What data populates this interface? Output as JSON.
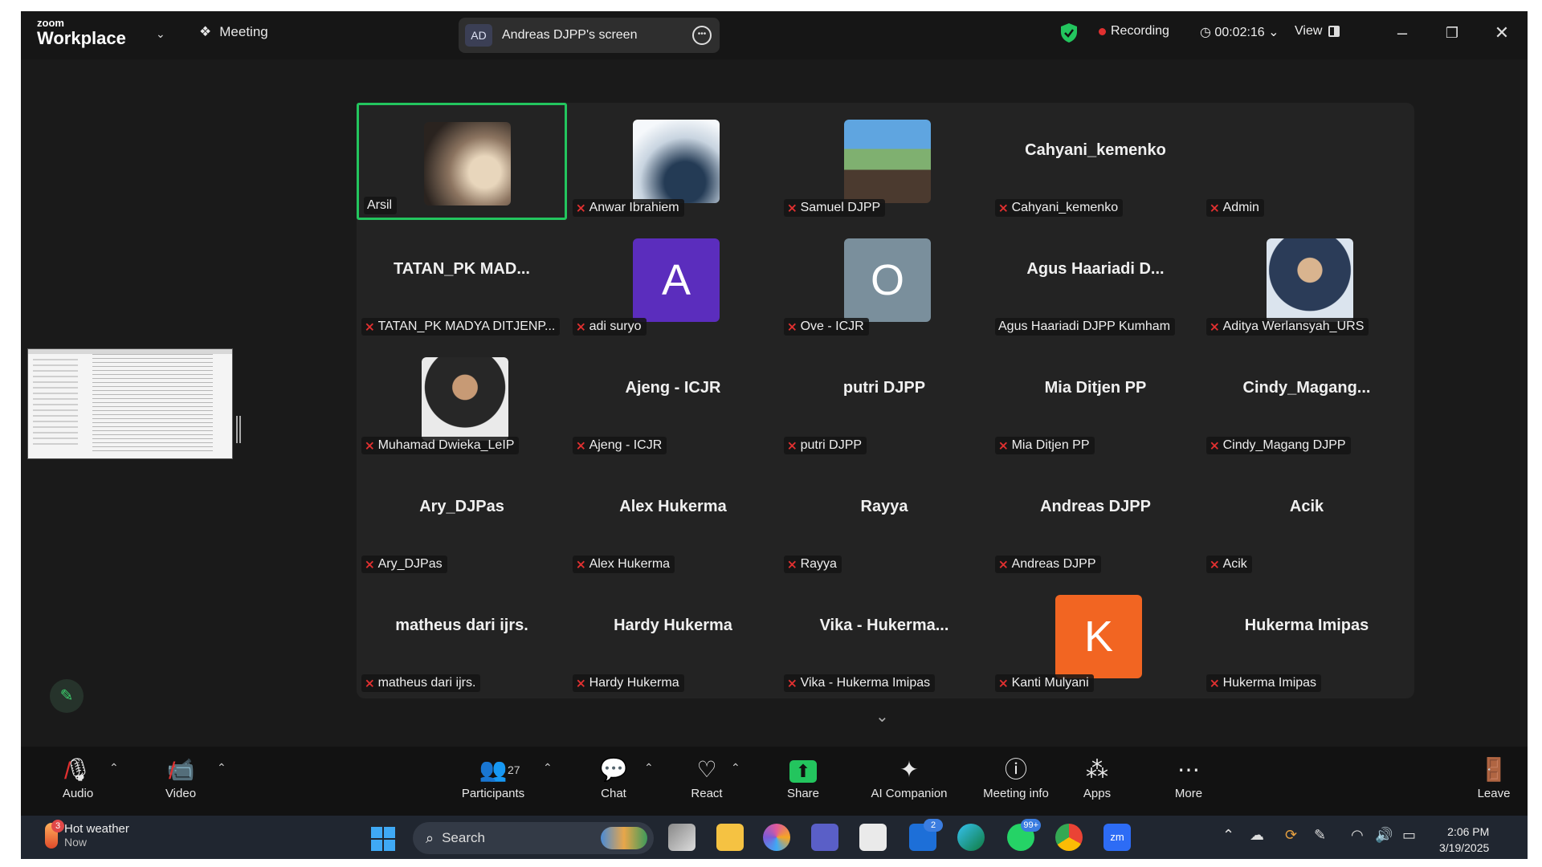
{
  "topbar": {
    "brand_small": "zoom",
    "brand_big": "Workplace",
    "meeting_label": "Meeting",
    "share_initials": "AD",
    "share_text": "Andreas DJPP's screen",
    "recording_label": "Recording",
    "timer": "00:02:16",
    "view_label": "View"
  },
  "participants": [
    {
      "name": "Arsil",
      "display": "",
      "avatar": "photo-arsil",
      "muted": false,
      "active": true
    },
    {
      "name": "Anwar Ibrahiem",
      "display": "",
      "avatar": "photo-anwar",
      "muted": true
    },
    {
      "name": "Samuel DJPP",
      "display": "",
      "avatar": "photo-samuel",
      "muted": true
    },
    {
      "name": "Cahyani_kemenko",
      "display": "Cahyani_kemenko",
      "muted": true
    },
    {
      "name": "Admin",
      "display": "",
      "muted": true
    },
    {
      "name": "TATAN_PK MADYA DITJENP...",
      "display": "TATAN_PK MAD...",
      "muted": true
    },
    {
      "name": "adi suryo",
      "display": "",
      "letter": "A",
      "color": "#5b2dbd",
      "muted": true
    },
    {
      "name": "Ove - ICJR",
      "display": "",
      "letter": "O",
      "color": "#7a8f9c",
      "muted": true
    },
    {
      "name": "Agus Haariadi DJPP Kumham",
      "display": "Agus Haariadi D...",
      "muted": false
    },
    {
      "name": "Aditya Werlansyah_URS",
      "display": "",
      "avatar": "photo-aditya",
      "muted": true
    },
    {
      "name": "Muhamad Dwieka_LeIP",
      "display": "",
      "avatar": "photo-dwieka",
      "muted": true
    },
    {
      "name": "Ajeng - ICJR",
      "display": "Ajeng - ICJR",
      "muted": true
    },
    {
      "name": "putri DJPP",
      "display": "putri DJPP",
      "muted": true
    },
    {
      "name": "Mia Ditjen PP",
      "display": "Mia Ditjen PP",
      "muted": true
    },
    {
      "name": "Cindy_Magang DJPP",
      "display": "Cindy_Magang...",
      "muted": true
    },
    {
      "name": "Ary_DJPas",
      "display": "Ary_DJPas",
      "muted": true
    },
    {
      "name": "Alex Hukerma",
      "display": "Alex Hukerma",
      "muted": true
    },
    {
      "name": "Rayya",
      "display": "Rayya",
      "muted": true
    },
    {
      "name": "Andreas DJPP",
      "display": "Andreas DJPP",
      "muted": true
    },
    {
      "name": "Acik",
      "display": "Acik",
      "muted": true
    },
    {
      "name": "matheus dari ijrs.",
      "display": "matheus dari ijrs.",
      "muted": true
    },
    {
      "name": "Hardy Hukerma",
      "display": "Hardy Hukerma",
      "muted": true
    },
    {
      "name": "Vika - Hukerma Imipas",
      "display": "Vika - Hukerma...",
      "muted": true
    },
    {
      "name": "Kanti Mulyani",
      "display": "",
      "letter": "K",
      "color": "#f26522",
      "muted": true
    },
    {
      "name": "Hukerma Imipas",
      "display": "Hukerma Imipas",
      "muted": true
    }
  ],
  "toolbar": {
    "audio": "Audio",
    "video": "Video",
    "participants": "Participants",
    "participants_count": "27",
    "chat": "Chat",
    "react": "React",
    "share": "Share",
    "ai": "AI Companion",
    "info": "Meeting info",
    "apps": "Apps",
    "more": "More",
    "leave": "Leave"
  },
  "taskbar": {
    "weather_title": "Hot weather",
    "weather_sub": "Now",
    "weather_badge": "3",
    "search": "Search",
    "teams_badge": "2",
    "whatsapp_badge": "99+",
    "time": "2:06 PM",
    "date": "3/19/2025"
  },
  "colors": {
    "accent_green": "#23c55e",
    "record_red": "#e03030",
    "kanti": "#f26522",
    "adi": "#5b2dbd",
    "ove": "#7a8f9c"
  }
}
